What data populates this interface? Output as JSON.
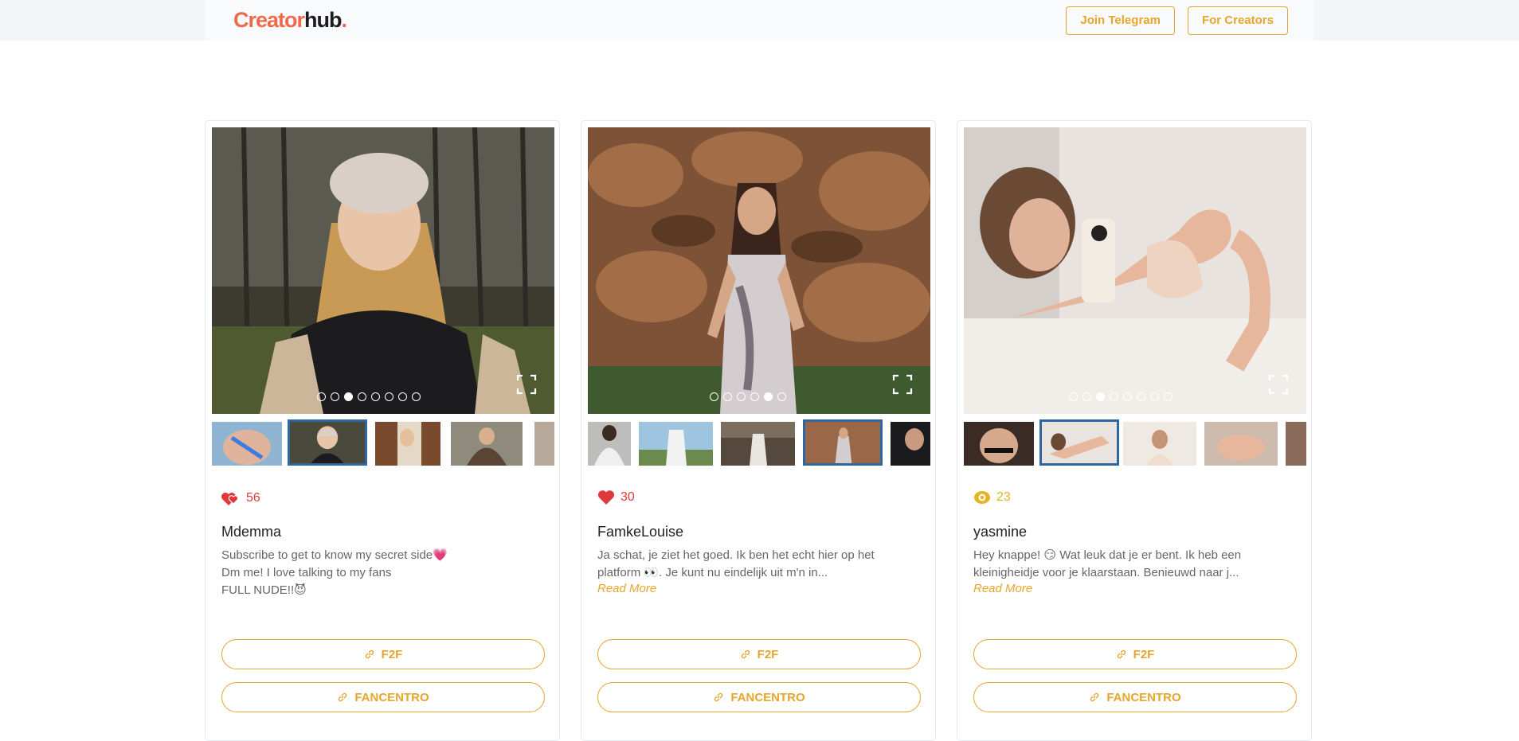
{
  "header": {
    "logo_main": "Creator",
    "logo_accent": "hub",
    "logo_dot": ".",
    "buttons": [
      "Join Telegram",
      "For Creators"
    ]
  },
  "colors": {
    "accent": "#e6a52c",
    "brand": "#ef6a4d",
    "like_red": "#e0393b",
    "views_gold": "#e6b323",
    "selected_thumb": "#2e66a4"
  },
  "cards": [
    {
      "metric_icon": "hearts-icon",
      "metric": "56",
      "name": "Mdemma",
      "description": [
        "Subscribe to get to know my secret side💗",
        "Dm me! I love talking to my fans",
        "FULL NUDE!!😈"
      ],
      "read_more": "",
      "carousel": {
        "slides": 8,
        "active_slide": 3
      },
      "links": [
        "F2F",
        "FANCENTRO"
      ]
    },
    {
      "metric_icon": "heart-icon",
      "metric": "30",
      "name": "FamkeLouise",
      "description": [
        "Ja schat, je ziet het goed. Ik ben het echt hier op het",
        "platform 👀. Je kunt nu eindelijk uit m'n in..."
      ],
      "read_more": "Read More",
      "carousel": {
        "slides": 6,
        "active_slide": 5
      },
      "links": [
        "F2F",
        "FANCENTRO"
      ]
    },
    {
      "metric_icon": "eye-icon",
      "metric": "23",
      "name": "yasmine",
      "description": [
        "Hey knappe! 😏 Wat leuk dat je er bent. Ik heb een",
        "kleinigheidje voor je klaarstaan. Benieuwd naar j..."
      ],
      "read_more": "Read More",
      "carousel": {
        "slides": 8,
        "active_slide": 3
      },
      "links": [
        "F2F",
        "FANCENTRO"
      ]
    }
  ]
}
